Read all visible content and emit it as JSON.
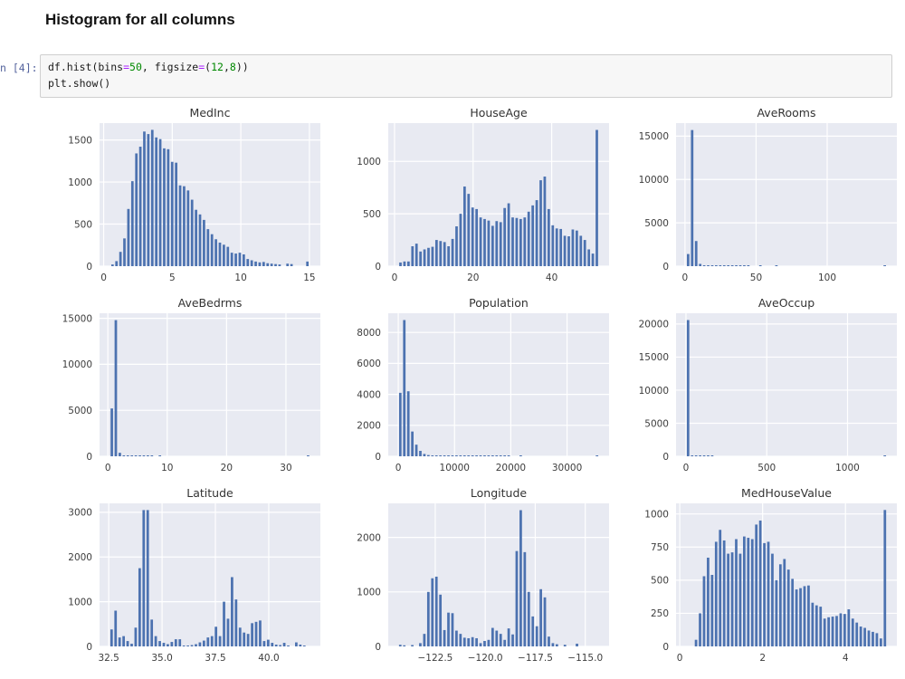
{
  "notebook": {
    "heading": "Histogram for all columns",
    "cell_prompt": "n [4]:",
    "code_tokens": [
      [
        {
          "t": "df.hist(bins",
          "c": "p"
        },
        {
          "t": "=",
          "c": "o"
        },
        {
          "t": "50",
          "c": "n"
        },
        {
          "t": ", figsize",
          "c": "p"
        },
        {
          "t": "=",
          "c": "o"
        },
        {
          "t": "(",
          "c": "p"
        },
        {
          "t": "12",
          "c": "n"
        },
        {
          "t": ",",
          "c": "p"
        },
        {
          "t": "8",
          "c": "n"
        },
        {
          "t": "))",
          "c": "p"
        }
      ],
      [
        {
          "t": "plt.show()",
          "c": "p"
        }
      ]
    ]
  },
  "colors": {
    "bar": "#4c72b0",
    "plot_bg": "#e8eaf2",
    "grid": "#ffffff",
    "tick_text": "#3d3d3d",
    "title_text": "#333333"
  },
  "chart_data": [
    {
      "type": "bar",
      "title": "MedInc",
      "grid": true,
      "data_min": 0.5,
      "data_max": 15.0,
      "xlim": [
        -0.3,
        15.8
      ],
      "ylim": [
        0,
        1700
      ],
      "xticks": [
        {
          "v": 0,
          "label": "0"
        },
        {
          "v": 5,
          "label": "5"
        },
        {
          "v": 10,
          "label": "10"
        },
        {
          "v": 15,
          "label": "15"
        }
      ],
      "yticks": [
        {
          "v": 0,
          "label": "0"
        },
        {
          "v": 500,
          "label": "500"
        },
        {
          "v": 1000,
          "label": "1000"
        },
        {
          "v": 1500,
          "label": "1500"
        }
      ],
      "values": [
        20,
        60,
        170,
        330,
        680,
        1010,
        1340,
        1420,
        1600,
        1570,
        1620,
        1530,
        1510,
        1400,
        1390,
        1240,
        1230,
        960,
        950,
        900,
        790,
        670,
        615,
        550,
        440,
        380,
        320,
        280,
        255,
        230,
        160,
        150,
        160,
        140,
        85,
        70,
        55,
        45,
        50,
        35,
        30,
        25,
        20,
        0,
        30,
        25,
        0,
        0,
        0,
        55
      ]
    },
    {
      "type": "bar",
      "title": "HouseAge",
      "grid": true,
      "data_min": 1,
      "data_max": 52,
      "xlim": [
        -1.6,
        54.6
      ],
      "ylim": [
        0,
        1365
      ],
      "xticks": [
        {
          "v": 0,
          "label": "0"
        },
        {
          "v": 20,
          "label": "20"
        },
        {
          "v": 40,
          "label": "40"
        }
      ],
      "yticks": [
        {
          "v": 0,
          "label": "0"
        },
        {
          "v": 500,
          "label": "500"
        },
        {
          "v": 1000,
          "label": "1000"
        }
      ],
      "values": [
        35,
        45,
        45,
        190,
        215,
        140,
        160,
        175,
        185,
        250,
        240,
        230,
        190,
        260,
        380,
        500,
        760,
        690,
        560,
        545,
        465,
        450,
        435,
        385,
        430,
        420,
        555,
        600,
        465,
        460,
        450,
        465,
        520,
        580,
        630,
        820,
        855,
        545,
        390,
        360,
        355,
        290,
        285,
        350,
        340,
        290,
        250,
        160,
        120,
        1300
      ]
    },
    {
      "type": "bar",
      "title": "AveRooms",
      "grid": true,
      "data_min": 0.8,
      "data_max": 141.9,
      "xlim": [
        -6.3,
        149.0
      ],
      "ylim": [
        0,
        16500
      ],
      "xticks": [
        {
          "v": 0,
          "label": "0"
        },
        {
          "v": 50,
          "label": "50"
        },
        {
          "v": 100,
          "label": "100"
        }
      ],
      "yticks": [
        {
          "v": 0,
          "label": "0"
        },
        {
          "v": 5000,
          "label": "5000"
        },
        {
          "v": 10000,
          "label": "10000"
        },
        {
          "v": 15000,
          "label": "15000"
        }
      ],
      "values": [
        1400,
        15700,
        2900,
        260,
        60,
        25,
        12,
        8,
        5,
        4,
        3,
        2,
        2,
        1,
        1,
        1,
        0,
        0,
        1,
        0,
        0,
        0,
        1,
        0,
        0,
        0,
        0,
        0,
        0,
        0,
        0,
        0,
        0,
        0,
        0,
        0,
        0,
        0,
        0,
        0,
        0,
        0,
        0,
        0,
        0,
        0,
        0,
        0,
        0,
        1
      ]
    },
    {
      "type": "bar",
      "title": "AveBedrms",
      "grid": true,
      "data_min": 0.33,
      "data_max": 34.07,
      "xlim": [
        -1.4,
        35.8
      ],
      "ylim": [
        0,
        15550
      ],
      "xticks": [
        {
          "v": 0,
          "label": "0"
        },
        {
          "v": 10,
          "label": "10"
        },
        {
          "v": 20,
          "label": "20"
        },
        {
          "v": 30,
          "label": "30"
        }
      ],
      "yticks": [
        {
          "v": 0,
          "label": "0"
        },
        {
          "v": 5000,
          "label": "5000"
        },
        {
          "v": 10000,
          "label": "10000"
        },
        {
          "v": 15000,
          "label": "15000"
        }
      ],
      "values": [
        5200,
        14800,
        380,
        90,
        25,
        10,
        5,
        3,
        2,
        1,
        1,
        0,
        1,
        0,
        0,
        0,
        0,
        0,
        0,
        0,
        0,
        0,
        0,
        0,
        0,
        0,
        0,
        0,
        0,
        0,
        0,
        0,
        0,
        0,
        0,
        0,
        0,
        0,
        0,
        0,
        0,
        0,
        0,
        0,
        0,
        0,
        0,
        0,
        0,
        1
      ]
    },
    {
      "type": "bar",
      "title": "Population",
      "grid": true,
      "data_min": 3,
      "data_max": 35682,
      "xlim": [
        -1781,
        37466
      ],
      "ylim": [
        0,
        9240
      ],
      "xticks": [
        {
          "v": 0,
          "label": "0"
        },
        {
          "v": 10000,
          "label": "10000"
        },
        {
          "v": 20000,
          "label": "20000"
        },
        {
          "v": 30000,
          "label": "30000"
        }
      ],
      "yticks": [
        {
          "v": 0,
          "label": "0"
        },
        {
          "v": 2000,
          "label": "2000"
        },
        {
          "v": 4000,
          "label": "4000"
        },
        {
          "v": 6000,
          "label": "6000"
        },
        {
          "v": 8000,
          "label": "8000"
        }
      ],
      "values": [
        4100,
        8800,
        4200,
        1600,
        750,
        350,
        150,
        80,
        50,
        30,
        20,
        15,
        12,
        10,
        8,
        6,
        5,
        4,
        3,
        3,
        2,
        2,
        2,
        1,
        1,
        1,
        1,
        1,
        0,
        0,
        1,
        0,
        0,
        0,
        0,
        0,
        0,
        0,
        0,
        0,
        0,
        0,
        0,
        0,
        0,
        0,
        0,
        0,
        0,
        1
      ]
    },
    {
      "type": "bar",
      "title": "AveOccup",
      "grid": true,
      "data_min": 0.7,
      "data_max": 1243.3,
      "xlim": [
        -61.4,
        1305.4
      ],
      "ylim": [
        0,
        21630
      ],
      "xticks": [
        {
          "v": 0,
          "label": "0"
        },
        {
          "v": 500,
          "label": "500"
        },
        {
          "v": 1000,
          "label": "1000"
        }
      ],
      "yticks": [
        {
          "v": 0,
          "label": "0"
        },
        {
          "v": 5000,
          "label": "5000"
        },
        {
          "v": 10000,
          "label": "10000"
        },
        {
          "v": 15000,
          "label": "15000"
        },
        {
          "v": 20000,
          "label": "20000"
        }
      ],
      "values": [
        20600,
        35,
        6,
        3,
        2,
        1,
        1,
        0,
        0,
        0,
        0,
        0,
        0,
        0,
        0,
        0,
        0,
        0,
        0,
        0,
        0,
        0,
        0,
        0,
        0,
        0,
        0,
        0,
        0,
        0,
        0,
        0,
        0,
        0,
        0,
        0,
        0,
        0,
        0,
        0,
        0,
        0,
        0,
        0,
        0,
        0,
        0,
        0,
        0,
        1
      ]
    },
    {
      "type": "bar",
      "title": "Latitude",
      "grid": true,
      "data_min": 32.54,
      "data_max": 41.95,
      "xlim": [
        32.07,
        42.42
      ],
      "ylim": [
        0,
        3200
      ],
      "xticks": [
        {
          "v": 32.5,
          "label": "32.5"
        },
        {
          "v": 35.0,
          "label": "35.0"
        },
        {
          "v": 37.5,
          "label": "37.5"
        },
        {
          "v": 40.0,
          "label": "40.0"
        }
      ],
      "yticks": [
        {
          "v": 0,
          "label": "0"
        },
        {
          "v": 1000,
          "label": "1000"
        },
        {
          "v": 2000,
          "label": "2000"
        },
        {
          "v": 3000,
          "label": "3000"
        }
      ],
      "values": [
        380,
        800,
        200,
        230,
        120,
        60,
        420,
        1750,
        3050,
        3050,
        600,
        230,
        120,
        80,
        50,
        100,
        160,
        160,
        20,
        10,
        30,
        50,
        90,
        130,
        200,
        230,
        440,
        230,
        1000,
        620,
        1550,
        1050,
        420,
        310,
        280,
        520,
        550,
        580,
        120,
        150,
        80,
        40,
        30,
        80,
        20,
        0,
        90,
        40,
        10,
        0
      ]
    },
    {
      "type": "bar",
      "title": "Longitude",
      "grid": true,
      "data_min": -124.35,
      "data_max": -114.31,
      "xlim": [
        -124.85,
        -113.81
      ],
      "ylim": [
        0,
        2625
      ],
      "xticks": [
        {
          "v": -122.5,
          "label": "−122.5"
        },
        {
          "v": -120.0,
          "label": "−120.0"
        },
        {
          "v": -117.5,
          "label": "−117.5"
        },
        {
          "v": -115.0,
          "label": "−115.0"
        }
      ],
      "yticks": [
        {
          "v": 0,
          "label": "0"
        },
        {
          "v": 1000,
          "label": "1000"
        },
        {
          "v": 2000,
          "label": "2000"
        }
      ],
      "values": [
        30,
        20,
        0,
        25,
        0,
        60,
        230,
        1000,
        1250,
        1280,
        950,
        300,
        620,
        610,
        290,
        230,
        160,
        150,
        170,
        150,
        60,
        100,
        120,
        340,
        290,
        230,
        120,
        330,
        220,
        1750,
        2500,
        1730,
        1000,
        550,
        370,
        1050,
        900,
        180,
        60,
        40,
        0,
        30,
        0,
        0,
        50,
        0,
        0,
        0,
        0,
        0
      ]
    },
    {
      "type": "bar",
      "title": "MedHouseValue",
      "grid": true,
      "data_min": 0.15,
      "data_max": 5.0,
      "xlim": [
        -0.09,
        5.24
      ],
      "ylim": [
        0,
        1080
      ],
      "xticks": [
        {
          "v": 0,
          "label": "0"
        },
        {
          "v": 2,
          "label": "2"
        },
        {
          "v": 4,
          "label": "4"
        }
      ],
      "yticks": [
        {
          "v": 0,
          "label": "0"
        },
        {
          "v": 250,
          "label": "250"
        },
        {
          "v": 500,
          "label": "500"
        },
        {
          "v": 750,
          "label": "750"
        },
        {
          "v": 1000,
          "label": "1000"
        }
      ],
      "values": [
        0,
        0,
        50,
        250,
        530,
        670,
        540,
        790,
        880,
        800,
        700,
        710,
        810,
        700,
        830,
        820,
        810,
        920,
        950,
        780,
        790,
        700,
        500,
        620,
        660,
        580,
        510,
        430,
        440,
        455,
        460,
        330,
        310,
        300,
        210,
        220,
        225,
        230,
        250,
        245,
        280,
        210,
        180,
        150,
        140,
        120,
        110,
        100,
        60,
        1030
      ]
    }
  ]
}
